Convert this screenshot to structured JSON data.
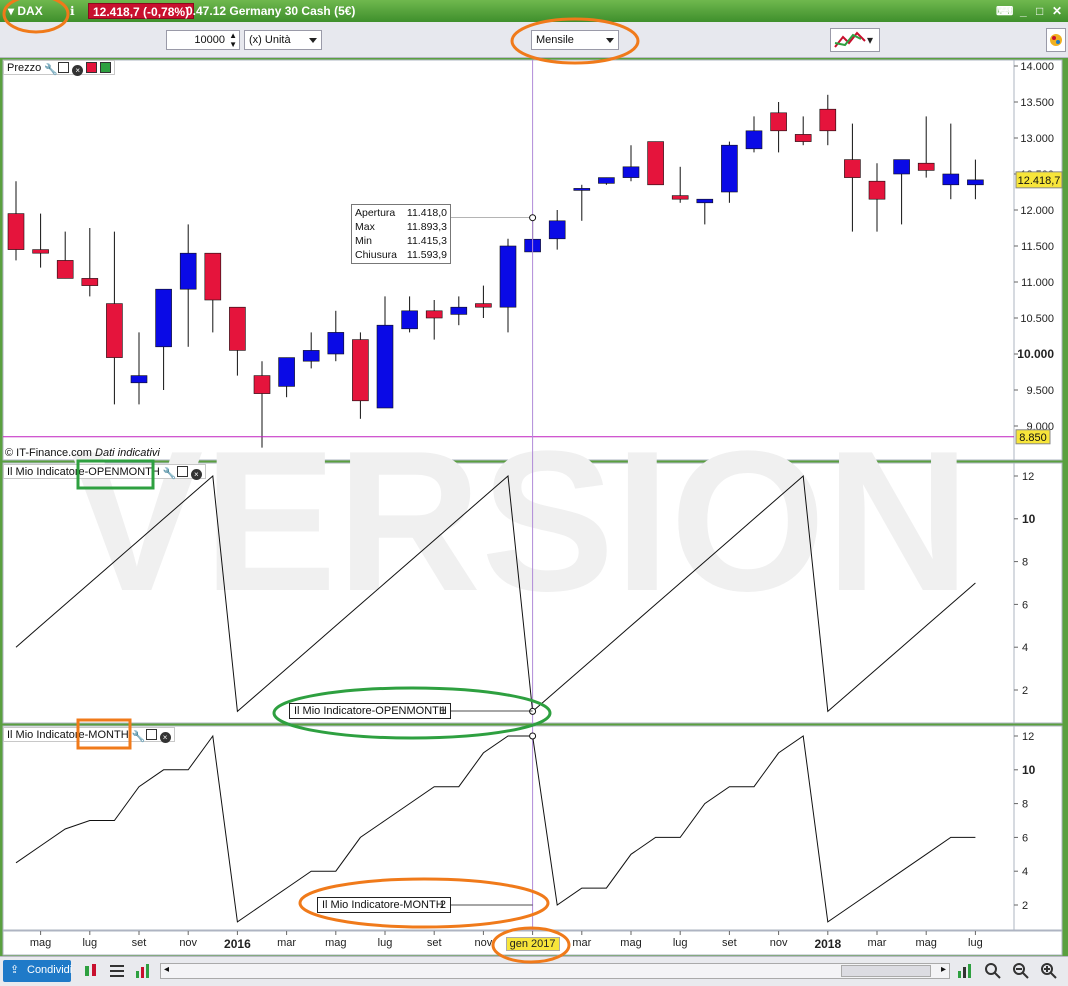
{
  "window": {
    "symbol": "DAX",
    "last_price_badge": "12.418,7 (-0,78%)",
    "instrument": "0.47.12 Germany 30 Cash (5€)"
  },
  "toolbar": {
    "quantity": "10000",
    "unit": "(x) Unità",
    "period": "Mensile"
  },
  "price_panel": {
    "label": "Prezzo",
    "copyright": "© IT-Finance.com",
    "copyright_note": "Dati indicativi",
    "current_price_tag": "12.418,7",
    "cursor_price_tag": "8.850",
    "watermark": "VERSION"
  },
  "tooltip": {
    "rows": [
      {
        "k": "Apertura",
        "v": "11.418,0"
      },
      {
        "k": "Max",
        "v": "11.893,3"
      },
      {
        "k": "Min",
        "v": "11.415,3"
      },
      {
        "k": "Chiusura",
        "v": "11.593,9"
      }
    ]
  },
  "indicator1": {
    "label": "Il Mio Indicatore-OPENMONTH",
    "cursor_tag": "Il Mio Indicatore-OPENMONTH",
    "cursor_value": "1"
  },
  "indicator2": {
    "label": "Il Mio Indicatore-MONTH",
    "cursor_tag": "Il Mio Indicatore-MONTH",
    "cursor_value": "2"
  },
  "bottom": {
    "share_label": "Condividi",
    "cursor_date": "gen 2017"
  },
  "colors": {
    "up": "#0a0ae6",
    "down": "#e5143c",
    "highlight_orange": "#f07a1a",
    "highlight_green": "#2ea040"
  },
  "chart_data": [
    {
      "type": "candlestick",
      "panel": "Prezzo",
      "x": [
        "2015-04",
        "2015-05",
        "2015-06",
        "2015-07",
        "2015-08",
        "2015-09",
        "2015-10",
        "2015-11",
        "2015-12",
        "2016-01",
        "2016-02",
        "2016-03",
        "2016-04",
        "2016-05",
        "2016-06",
        "2016-07",
        "2016-08",
        "2016-09",
        "2016-10",
        "2016-11",
        "2016-12",
        "2017-01",
        "2017-02",
        "2017-03",
        "2017-04",
        "2017-05",
        "2017-06",
        "2017-07",
        "2017-08",
        "2017-09",
        "2017-10",
        "2017-11",
        "2017-12",
        "2018-01",
        "2018-02",
        "2018-03",
        "2018-04",
        "2018-05",
        "2018-06",
        "2018-07"
      ],
      "open": [
        11950,
        11450,
        11300,
        11050,
        10700,
        9600,
        10100,
        10900,
        11400,
        10650,
        9700,
        9550,
        9900,
        10000,
        10200,
        9250,
        10350,
        10600,
        10550,
        10700,
        10650,
        11418,
        11600,
        12300,
        12370,
        12450,
        12950,
        12200,
        12100,
        12250,
        12850,
        13350,
        13050,
        13400,
        12700,
        12400,
        12500,
        12650,
        12350,
        12350
      ],
      "high": [
        12400,
        11950,
        11700,
        11750,
        11700,
        10300,
        10800,
        11800,
        11400,
        10650,
        9900,
        9950,
        10300,
        10600,
        10300,
        10800,
        10800,
        10750,
        10800,
        10950,
        11600,
        11893,
        12000,
        12350,
        12450,
        12900,
        12950,
        12600,
        12150,
        12950,
        13300,
        13500,
        13300,
        13600,
        13200,
        12650,
        12650,
        13300,
        13200,
        12700
      ],
      "low": [
        11300,
        11200,
        11050,
        10800,
        9300,
        9300,
        9500,
        10100,
        10300,
        9700,
        8700,
        9400,
        9800,
        9900,
        9100,
        9300,
        10300,
        10200,
        10400,
        10500,
        10300,
        11415,
        11450,
        11850,
        12350,
        12400,
        12350,
        12100,
        11800,
        12100,
        12800,
        12800,
        12900,
        12900,
        11700,
        11700,
        11800,
        12450,
        12150,
        12150
      ],
      "close": [
        11450,
        11400,
        11050,
        10950,
        9950,
        9700,
        10900,
        11400,
        10750,
        10050,
        9450,
        9950,
        10050,
        10300,
        9350,
        10400,
        10600,
        10500,
        10650,
        10650,
        11500,
        11594,
        11850,
        12300,
        12450,
        12600,
        12350,
        12150,
        12150,
        12900,
        13100,
        13100,
        12950,
        13100,
        12450,
        12150,
        12700,
        12550,
        12500,
        12418.7
      ],
      "ylim": [
        8500,
        14000
      ],
      "y_ticks": [
        "9.000",
        "9.500",
        "10.000",
        "10.500",
        "11.000",
        "11.500",
        "12.000",
        "12.500",
        "13.000",
        "13.500",
        "14.000"
      ],
      "x_tick_labels": [
        "mag",
        "lug",
        "set",
        "nov",
        "2016",
        "mar",
        "mag",
        "lug",
        "set",
        "nov",
        "gen 2017",
        "mar",
        "mag",
        "lug",
        "set",
        "nov",
        "2018",
        "mar",
        "mag",
        "lug"
      ]
    },
    {
      "type": "line",
      "panel": "Il Mio Indicatore-OPENMONTH",
      "x": [
        "2015-04",
        "2015-05",
        "2015-06",
        "2015-07",
        "2015-08",
        "2015-09",
        "2015-10",
        "2015-11",
        "2015-12",
        "2016-01",
        "2016-02",
        "2016-03",
        "2016-04",
        "2016-05",
        "2016-06",
        "2016-07",
        "2016-08",
        "2016-09",
        "2016-10",
        "2016-11",
        "2016-12",
        "2017-01",
        "2017-02",
        "2017-03",
        "2017-04",
        "2017-05",
        "2017-06",
        "2017-07",
        "2017-08",
        "2017-09",
        "2017-10",
        "2017-11",
        "2017-12",
        "2018-01",
        "2018-02",
        "2018-03",
        "2018-04",
        "2018-05",
        "2018-06",
        "2018-07"
      ],
      "values": [
        4,
        5,
        6,
        7,
        8,
        9,
        10,
        11,
        12,
        1,
        2,
        3,
        4,
        5,
        6,
        7,
        8,
        9,
        10,
        11,
        12,
        1,
        2,
        3,
        4,
        5,
        6,
        7,
        8,
        9,
        10,
        11,
        12,
        1,
        2,
        3,
        4,
        5,
        6,
        7
      ],
      "ylim": [
        0.5,
        12.5
      ],
      "y_ticks": [
        "2",
        "4",
        "6",
        "8",
        "10",
        "12"
      ]
    },
    {
      "type": "line",
      "panel": "Il Mio Indicatore-MONTH",
      "x": [
        "2015-04",
        "2015-05",
        "2015-06",
        "2015-07",
        "2015-08",
        "2015-09",
        "2015-10",
        "2015-11",
        "2015-12",
        "2016-01",
        "2016-02",
        "2016-03",
        "2016-04",
        "2016-05",
        "2016-06",
        "2016-07",
        "2016-08",
        "2016-09",
        "2016-10",
        "2016-11",
        "2016-12",
        "2017-01",
        "2017-02",
        "2017-03",
        "2017-04",
        "2017-05",
        "2017-06",
        "2017-07",
        "2017-08",
        "2017-09",
        "2017-10",
        "2017-11",
        "2017-12",
        "2018-01",
        "2018-02",
        "2018-03",
        "2018-04",
        "2018-05",
        "2018-06",
        "2018-07"
      ],
      "values": [
        4.5,
        5.5,
        6.5,
        7,
        7,
        9,
        10,
        10,
        12,
        1,
        2,
        3,
        4,
        4,
        6,
        7,
        8,
        9,
        9,
        11,
        12,
        12,
        2,
        3,
        3,
        5,
        6,
        6,
        8,
        9,
        9,
        11,
        12,
        1,
        2,
        3,
        4,
        5,
        6,
        6
      ],
      "ylim": [
        0.5,
        12.5
      ],
      "y_ticks": [
        "2",
        "4",
        "6",
        "8",
        "10",
        "12"
      ]
    }
  ]
}
